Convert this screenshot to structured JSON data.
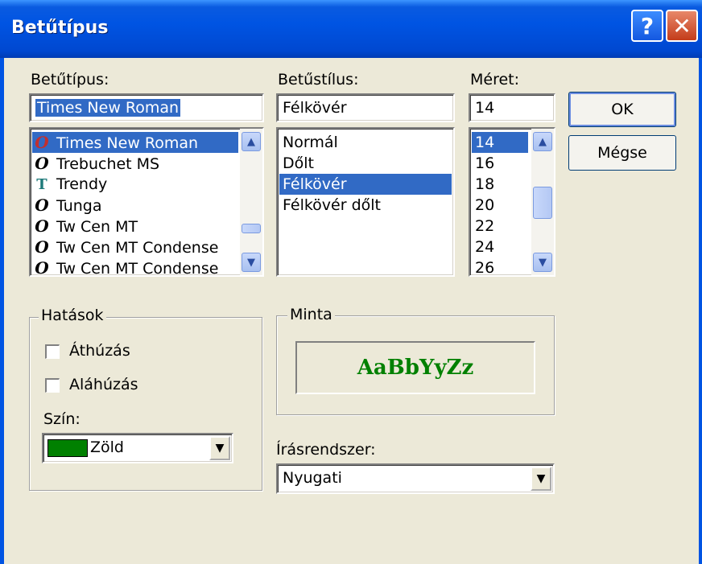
{
  "window": {
    "title": "Betűtípus",
    "help_label": "?",
    "close_label": "✕"
  },
  "font": {
    "label": "Betűtípus:",
    "value": "Times New Roman",
    "items": [
      {
        "label": "Times New Roman",
        "icon": "opentype-font-icon",
        "selected": true
      },
      {
        "label": "Trebuchet MS",
        "icon": "opentype-font-icon",
        "selected": false
      },
      {
        "label": "Trendy",
        "icon": "truetype-font-icon",
        "selected": false
      },
      {
        "label": "Tunga",
        "icon": "opentype-font-icon",
        "selected": false
      },
      {
        "label": "Tw Cen MT",
        "icon": "opentype-font-icon",
        "selected": false
      },
      {
        "label": "Tw Cen MT Condense",
        "icon": "opentype-font-icon",
        "selected": false
      },
      {
        "label": "Tw Cen MT Condense",
        "icon": "opentype-font-icon",
        "selected": false
      }
    ]
  },
  "style": {
    "label": "Betűstílus:",
    "value": "Félkövér",
    "items": [
      {
        "label": "Normál",
        "selected": false
      },
      {
        "label": "Dőlt",
        "selected": false
      },
      {
        "label": "Félkövér",
        "selected": true
      },
      {
        "label": "Félkövér dőlt",
        "selected": false
      }
    ]
  },
  "size": {
    "label": "Méret:",
    "value": "14",
    "items": [
      "14",
      "16",
      "18",
      "20",
      "22",
      "24",
      "26"
    ],
    "selected_index": 0
  },
  "buttons": {
    "ok": "OK",
    "cancel": "Mégse"
  },
  "effects": {
    "title": "Hatások",
    "strikeout": "Áthúzás",
    "underline": "Aláhúzás",
    "strikeout_checked": false,
    "underline_checked": false,
    "color_label": "Szín:",
    "color_value": "Zöld",
    "color_hex": "#008000"
  },
  "sample": {
    "title": "Minta",
    "text": "AaBbYyZz"
  },
  "script": {
    "label": "Írásrendszer:",
    "value": "Nyugati"
  }
}
